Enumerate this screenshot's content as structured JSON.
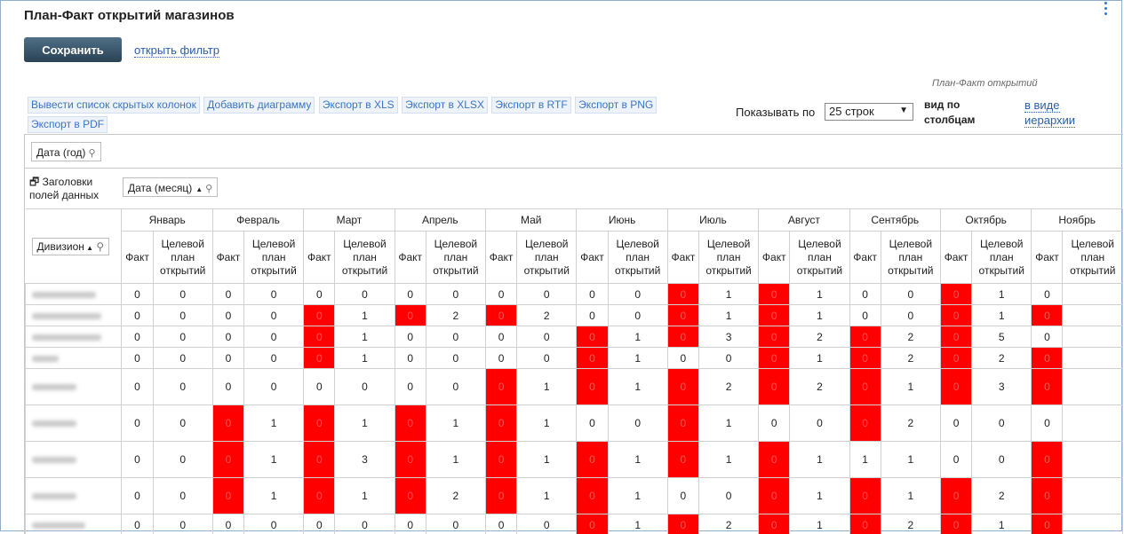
{
  "page": {
    "title": "План-Факт открытий магазинов"
  },
  "toolbar": {
    "save_label": "Сохранить",
    "filter_link": "открыть фильтр"
  },
  "report": {
    "caption": "План-Факт открытий"
  },
  "exports": [
    "Вывести список скрытых колонок",
    "Добавить диаграмму",
    "Экспорт в XLS",
    "Экспорт в XLSX",
    "Экспорт в RTF",
    "Экспорт в PNG",
    "Экспорт в PDF"
  ],
  "paging": {
    "label": "Показывать по",
    "selected": "25 строк"
  },
  "view": {
    "label_line1": "вид по",
    "label_line2": "столбцам",
    "link_line1": "в виде",
    "link_line2": "иерархии"
  },
  "pivot": {
    "year_field": "Дата (год)",
    "headers_toggle_line1": "Заголовки",
    "headers_toggle_line2": "полей данных",
    "month_field": "Дата (месяц)",
    "row_field": "Дивизион",
    "months": [
      "Январь",
      "Февраль",
      "Март",
      "Апрель",
      "Май",
      "Июнь",
      "Июль",
      "Август",
      "Сентябрь",
      "Октябрь",
      "Ноябрь"
    ],
    "col_fact": "Факт",
    "col_plan": "Целевой план открытий",
    "status_colors": {
      "miss": "#ff0000"
    },
    "rows": [
      {
        "values": [
          "0",
          "0",
          "0",
          "0",
          "0",
          "0",
          "0",
          "0",
          "0",
          "0",
          "0",
          "0",
          "0",
          "1",
          "0",
          "1",
          "0",
          "0",
          "0",
          "1",
          "0",
          ""
        ],
        "red": [
          12,
          14,
          18
        ]
      },
      {
        "values": [
          "0",
          "0",
          "0",
          "0",
          "0",
          "1",
          "0",
          "2",
          "0",
          "2",
          "0",
          "0",
          "0",
          "1",
          "0",
          "1",
          "0",
          "0",
          "0",
          "1",
          "0",
          ""
        ],
        "red": [
          4,
          6,
          8,
          12,
          14,
          18,
          20
        ]
      },
      {
        "values": [
          "0",
          "0",
          "0",
          "0",
          "0",
          "1",
          "0",
          "0",
          "0",
          "0",
          "0",
          "1",
          "0",
          "3",
          "0",
          "2",
          "0",
          "2",
          "0",
          "5",
          "0",
          ""
        ],
        "red": [
          4,
          10,
          12,
          14,
          16,
          18
        ]
      },
      {
        "values": [
          "0",
          "0",
          "0",
          "0",
          "0",
          "1",
          "0",
          "0",
          "0",
          "0",
          "0",
          "1",
          "0",
          "0",
          "0",
          "1",
          "0",
          "2",
          "0",
          "2",
          "0",
          ""
        ],
        "red": [
          4,
          10,
          14,
          16,
          18,
          20
        ]
      },
      {
        "values": [
          "0",
          "0",
          "0",
          "0",
          "0",
          "0",
          "0",
          "0",
          "0",
          "1",
          "0",
          "1",
          "0",
          "2",
          "0",
          "2",
          "0",
          "1",
          "0",
          "3",
          "0",
          ""
        ],
        "red": [
          8,
          10,
          12,
          14,
          16,
          18,
          20
        ]
      },
      {
        "values": [
          "0",
          "0",
          "0",
          "1",
          "0",
          "1",
          "0",
          "1",
          "0",
          "1",
          "0",
          "0",
          "0",
          "1",
          "0",
          "0",
          "0",
          "2",
          "0",
          "0",
          "0",
          ""
        ],
        "red": [
          2,
          4,
          6,
          8,
          12,
          16
        ]
      },
      {
        "values": [
          "0",
          "0",
          "0",
          "1",
          "0",
          "3",
          "0",
          "1",
          "0",
          "1",
          "0",
          "1",
          "0",
          "1",
          "0",
          "1",
          "1",
          "1",
          "0",
          "0",
          "0",
          ""
        ],
        "red": [
          2,
          4,
          6,
          8,
          10,
          12,
          14,
          20
        ]
      },
      {
        "values": [
          "0",
          "0",
          "0",
          "1",
          "0",
          "1",
          "0",
          "2",
          "0",
          "1",
          "0",
          "1",
          "0",
          "0",
          "0",
          "1",
          "0",
          "1",
          "0",
          "2",
          "0",
          ""
        ],
        "red": [
          2,
          4,
          6,
          8,
          10,
          14,
          16,
          18,
          20
        ]
      },
      {
        "values": [
          "0",
          "0",
          "0",
          "0",
          "0",
          "0",
          "0",
          "0",
          "0",
          "0",
          "0",
          "1",
          "0",
          "2",
          "0",
          "1",
          "0",
          "2",
          "0",
          "1",
          "0",
          ""
        ],
        "red": [
          10,
          12,
          14,
          16,
          18,
          20
        ]
      }
    ]
  }
}
